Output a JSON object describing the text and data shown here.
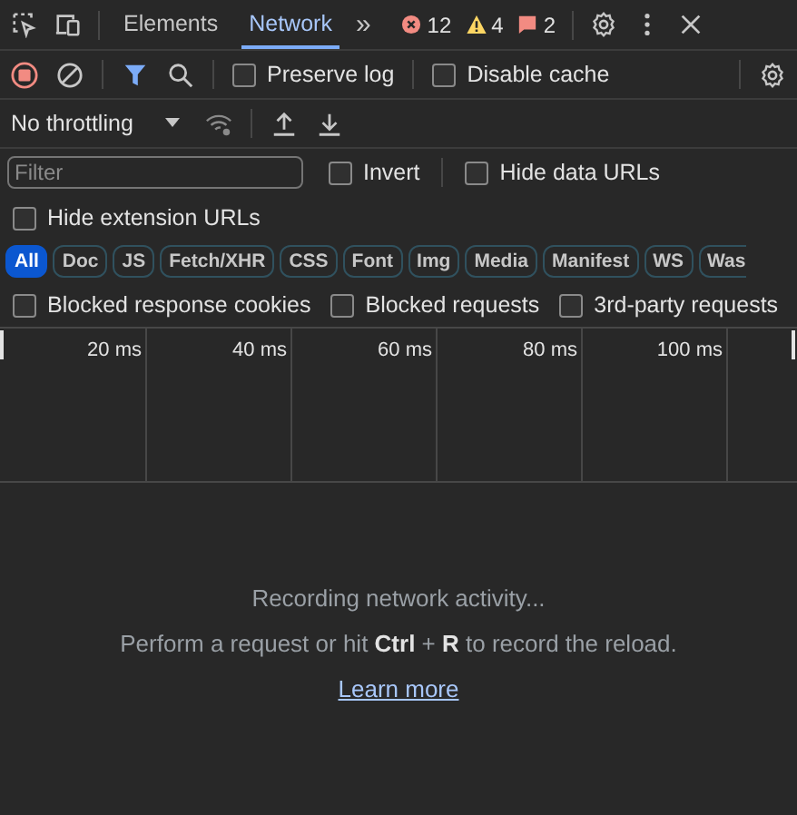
{
  "main_tabs": [
    {
      "label": "Elements",
      "selected": false
    },
    {
      "label": "Network",
      "selected": true
    }
  ],
  "more_tabs": "»",
  "counts": [
    {
      "kind": "error",
      "value": "12"
    },
    {
      "kind": "warning",
      "value": "4"
    },
    {
      "kind": "issue",
      "value": "2"
    }
  ],
  "toolbar": {
    "recording": true,
    "preserve_log": {
      "label": "Preserve log",
      "checked": false
    },
    "disable_cache": {
      "label": "Disable cache",
      "checked": false
    }
  },
  "throttling": {
    "value": "No throttling"
  },
  "filter": {
    "placeholder": "Filter",
    "invert": {
      "label": "Invert",
      "checked": false
    },
    "hide_data_urls": {
      "label": "Hide data URLs",
      "checked": false
    },
    "hide_extension_urls": {
      "label": "Hide extension URLs",
      "checked": false
    }
  },
  "type_filters": [
    {
      "label": "All",
      "selected": true
    },
    {
      "label": "Doc",
      "selected": false
    },
    {
      "label": "JS",
      "selected": false
    },
    {
      "label": "Fetch/XHR",
      "selected": false
    },
    {
      "label": "CSS",
      "selected": false
    },
    {
      "label": "Font",
      "selected": false
    },
    {
      "label": "Img",
      "selected": false
    },
    {
      "label": "Media",
      "selected": false
    },
    {
      "label": "Manifest",
      "selected": false
    },
    {
      "label": "WS",
      "selected": false
    },
    {
      "label": "Was",
      "selected": false
    }
  ],
  "blocked_filters": [
    {
      "label": "Blocked response cookies",
      "checked": false
    },
    {
      "label": "Blocked requests",
      "checked": false
    },
    {
      "label": "3rd-party requests",
      "checked": false
    }
  ],
  "timeline": {
    "ticks": [
      "20 ms",
      "40 ms",
      "60 ms",
      "80 ms",
      "100 ms"
    ]
  },
  "empty_state": {
    "title": "Recording network activity...",
    "hint": "Perform a request or hit **Ctrl** + **R** to record the reload.",
    "link": "Learn more"
  }
}
